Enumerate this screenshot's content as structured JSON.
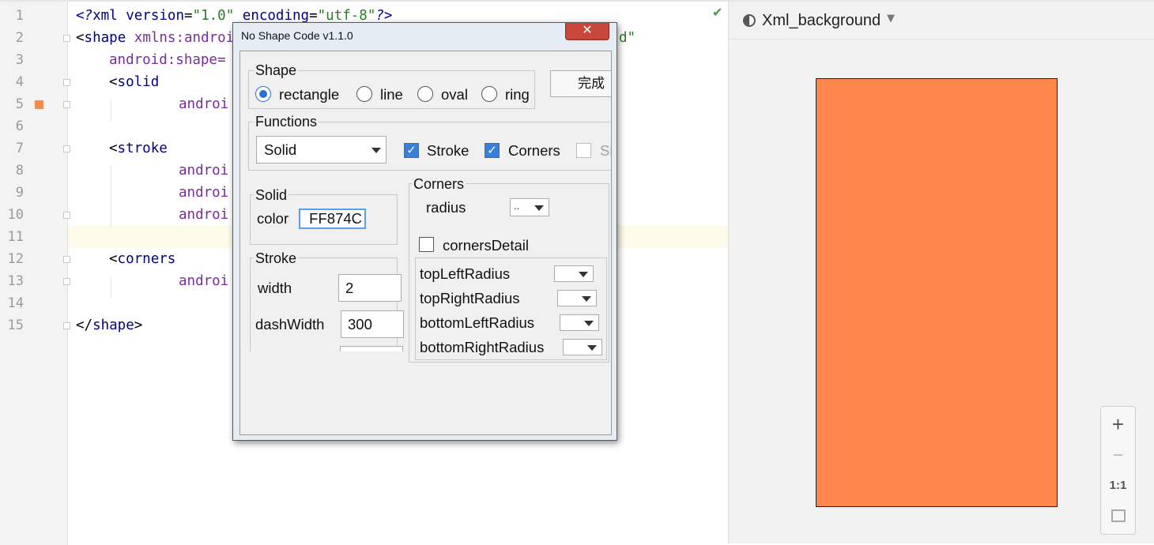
{
  "editor": {
    "lines": [
      {
        "n": "1"
      },
      {
        "n": "2"
      },
      {
        "n": "3"
      },
      {
        "n": "4"
      },
      {
        "n": "5"
      },
      {
        "n": "6"
      },
      {
        "n": "7"
      },
      {
        "n": "8"
      },
      {
        "n": "9"
      },
      {
        "n": "10"
      },
      {
        "n": "11"
      },
      {
        "n": "12"
      },
      {
        "n": "13"
      },
      {
        "n": "14"
      },
      {
        "n": "15"
      }
    ],
    "code": {
      "l1_open": "<?",
      "l1_tag": "xml",
      "l1_sp1": " ",
      "l1_attr1": "version",
      "l1_eq1": "=",
      "l1_val1": "\"1.0\"",
      "l1_sp2": " ",
      "l1_attr2": "encoding",
      "l1_eq2": "=",
      "l1_val2": "\"utf-8\"",
      "l1_close": "?>",
      "l2_open": "<",
      "l2_tag": "shape",
      "l2_sp": " ",
      "l2_attr": "xmlns:androi",
      "l2_tail": "d\"",
      "l3_attr": "android:shape=",
      "l4_open": "<",
      "l4_tag": "solid",
      "l5_attr": "androi",
      "l7_open": "<",
      "l7_tag": "stroke",
      "l8_attr": "androi",
      "l9_attr": "androi",
      "l10_attr": "androi",
      "l12_open": "<",
      "l12_tag": "corners",
      "l13_attr": "androi",
      "l15_open": "</",
      "l15_tag": "shape",
      "l15_close": ">"
    }
  },
  "preview": {
    "title": "Xml_background",
    "shape_color": "#FF874C",
    "zoom_in": "+",
    "zoom_out": "−",
    "actual_size": "1:1"
  },
  "dialog": {
    "title": "No Shape Code v1.1.0",
    "close": "✕",
    "shape_group": "Shape",
    "shape_options": [
      "rectangle",
      "line",
      "oval",
      "ring"
    ],
    "shape_selected": "rectangle",
    "done_button": "完成",
    "functions_group": "Functions",
    "fill_type": "Solid",
    "stroke_label": "Stroke",
    "stroke_checked": true,
    "corners_label": "Corners",
    "corners_checked": true,
    "third_fn_label": "Si",
    "solid_group": "Solid",
    "color_label": "color",
    "color_value": "FF874C",
    "stroke_group": "Stroke",
    "width_label": "width",
    "width_value": "2",
    "dashwidth_label": "dashWidth",
    "dashwidth_value": "300",
    "corners_group": "Corners",
    "radius_label": "radius",
    "radius_value": "..",
    "corners_detail_label": "cornersDetail",
    "corners_detail_checked": false,
    "top_left_label": "topLeftRadius",
    "top_right_label": "topRightRadius",
    "bottom_left_label": "bottomLeftRadius",
    "bottom_right_label": "bottomRightRadius"
  }
}
